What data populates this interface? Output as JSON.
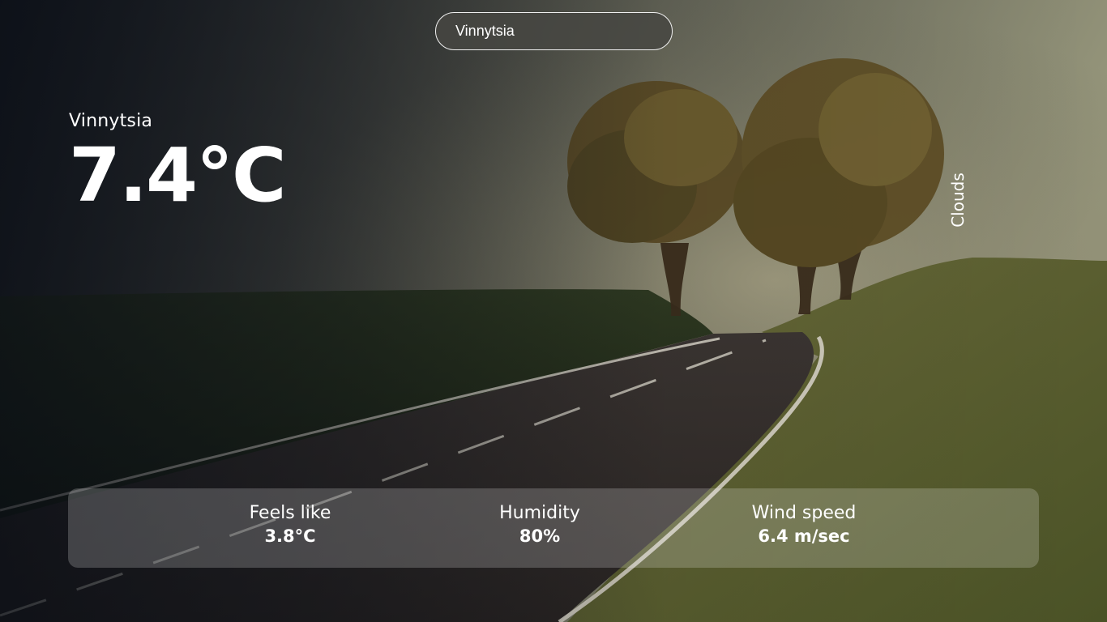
{
  "search": {
    "value": "Vinnytsia"
  },
  "current": {
    "location": "Vinnytsia",
    "temperature": "7.4°C",
    "description": "Clouds"
  },
  "stats": [
    {
      "label": "Feels like",
      "value": "3.8°C"
    },
    {
      "label": "Humidity",
      "value": "80%"
    },
    {
      "label": "Wind speed",
      "value": "6.4 m/sec"
    }
  ]
}
